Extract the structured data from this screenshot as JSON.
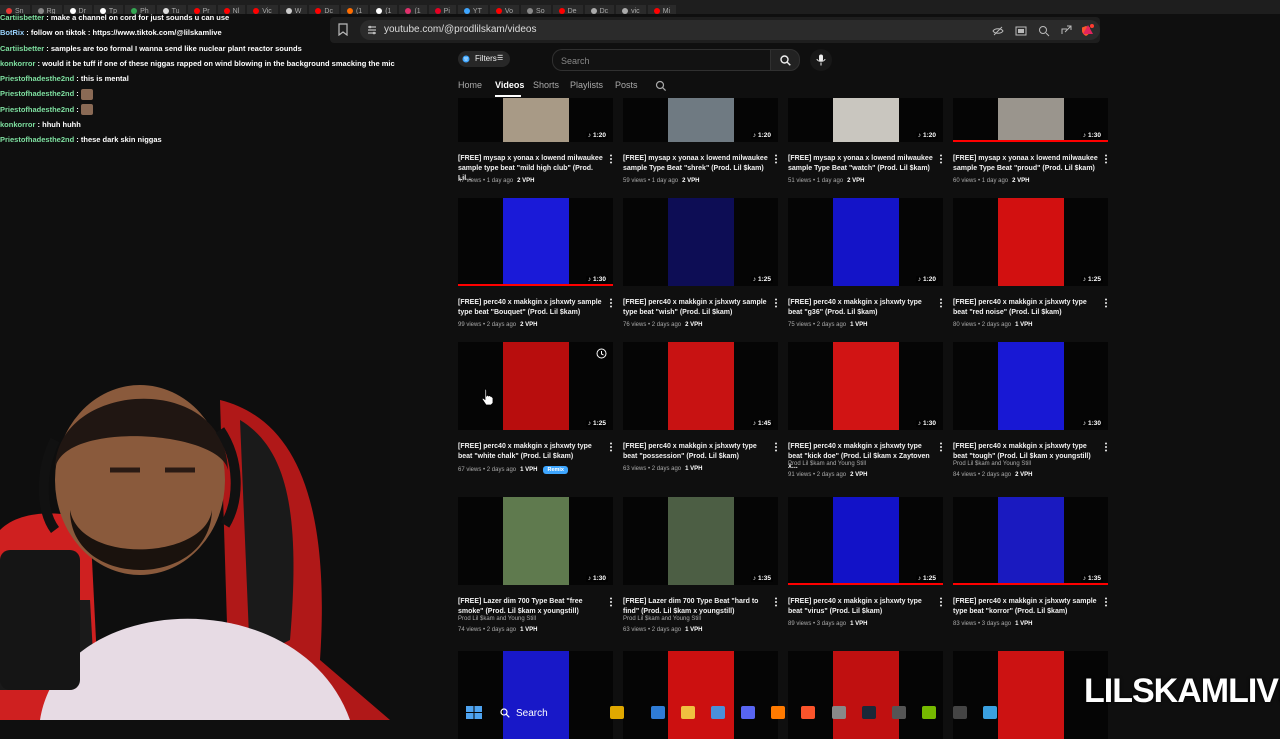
{
  "browser": {
    "tabs": [
      {
        "label": "Sn",
        "color": "#e53935"
      },
      {
        "label": "Rg",
        "color": "#888888"
      },
      {
        "label": "Dr",
        "color": "#ffffff"
      },
      {
        "label": "Tp",
        "color": "#ffffff"
      },
      {
        "label": "Ph",
        "color": "#34a853"
      },
      {
        "label": "Tu",
        "color": "#dddddd"
      },
      {
        "label": "Pr",
        "color": "#ff0000"
      },
      {
        "label": "Nl",
        "color": "#ff0000"
      },
      {
        "label": "Vic",
        "color": "#ff0000"
      },
      {
        "label": "W",
        "color": "#cccccc"
      },
      {
        "label": "Dc",
        "color": "#ff0000"
      },
      {
        "label": "(1",
        "color": "#ff6d00"
      },
      {
        "label": "(1",
        "color": "#ffffff"
      },
      {
        "label": "(1",
        "color": "#e1306c"
      },
      {
        "label": "Pi",
        "color": "#e60023"
      },
      {
        "label": "YT",
        "color": "#3ea6ff"
      },
      {
        "label": "Vo",
        "color": "#ff0000"
      },
      {
        "label": "So",
        "color": "#888888"
      },
      {
        "label": "De",
        "color": "#ff0000"
      },
      {
        "label": "Dc",
        "color": "#aaaaaa"
      },
      {
        "label": "vic",
        "color": "#aaaaaa"
      },
      {
        "label": "Mi",
        "color": "#ff0000"
      }
    ],
    "url": "youtube.com/@prodlilskam/videos"
  },
  "chat": [
    {
      "user": "Cartiisbetter",
      "msg": "make a channel on cord for just sounds u can use",
      "blue": false
    },
    {
      "user": "BotRix",
      "msg": "follow on tiktok : https://www.tiktok.com/@lilskamlive",
      "blue": true
    },
    {
      "user": "Cartiisbetter",
      "msg": "samples are too formal I wanna send like nuclear plant reactor sounds",
      "blue": false
    },
    {
      "user": "konkorror",
      "msg": "would it be tuff if one of these niggas rapped on wind blowing in the background smacking the mic",
      "blue": false
    },
    {
      "user": "Priestofhadesthe2nd",
      "msg": "this is mental",
      "blue": false
    },
    {
      "user": "Priestofhadesthe2nd",
      "msg": "",
      "blue": false,
      "emote": true
    },
    {
      "user": "Priestofhadesthe2nd",
      "msg": "",
      "blue": false,
      "emote": true
    },
    {
      "user": "konkorror",
      "msg": "hhuh huhh",
      "blue": false
    },
    {
      "user": "Priestofhadesthe2nd",
      "msg": "these dark skin niggas",
      "blue": false
    }
  ],
  "youtube": {
    "filters_label": "Filters",
    "search_placeholder": "Search",
    "channel_tabs": [
      "Home",
      "Videos",
      "Shorts",
      "Playlists",
      "Posts"
    ]
  },
  "videos": [
    {
      "title": "[FREE] mysap x yonaa x lowend milwaukee sample type beat \"mild high club\" (Prod. Lil...",
      "views": "47 views",
      "age": "1 day ago",
      "vph": "2 VPH",
      "duration": "1:20",
      "color": "#a89a86",
      "progress": 0,
      "channel": ""
    },
    {
      "title": "[FREE] mysap x yonaa x lowend milwaukee sample Type Beat \"shrek\" (Prod. Lil $kam)",
      "views": "59 views",
      "age": "1 day ago",
      "vph": "2 VPH",
      "duration": "1:20",
      "color": "#6f7a82",
      "progress": 0,
      "channel": ""
    },
    {
      "title": "[FREE] mysap x yonaa x lowend milwaukee sample Type Beat \"watch\" (Prod. Lil $kam)",
      "views": "51 views",
      "age": "1 day ago",
      "vph": "2 VPH",
      "duration": "1:20",
      "color": "#c9c6bf",
      "progress": 0,
      "channel": ""
    },
    {
      "title": "[FREE] mysap x yonaa x lowend milwaukee sample Type Beat \"proud\" (Prod. Lil $kam)",
      "views": "60 views",
      "age": "1 day ago",
      "vph": "2 VPH",
      "duration": "1:30",
      "color": "#9a958d",
      "progress": 1,
      "channel": ""
    },
    {
      "title": "[FREE] perc40 x makkgin x jshxwty sample type beat \"Bouquet\" (Prod. Lil $kam)",
      "views": "99 views",
      "age": "2 days ago",
      "vph": "2 VPH",
      "duration": "1:30",
      "color": "#1a1ad8",
      "progress": 1,
      "channel": ""
    },
    {
      "title": "[FREE] perc40 x makkgin x jshxwty sample type beat \"wish\" (Prod. Lil $kam)",
      "views": "76 views",
      "age": "2 days ago",
      "vph": "2 VPH",
      "duration": "1:25",
      "color": "#0d0d55",
      "progress": 0,
      "channel": ""
    },
    {
      "title": "[FREE] perc40 x makkgin x jshxwty type beat \"g36\" (Prod. Lil $kam)",
      "views": "75 views",
      "age": "2 days ago",
      "vph": "1 VPH",
      "duration": "1:20",
      "color": "#1414c8",
      "progress": 0,
      "channel": ""
    },
    {
      "title": "[FREE] perc40 x makkgin x jshxwty type beat \"red noise\" (Prod. Lil $kam)",
      "views": "80 views",
      "age": "2 days ago",
      "vph": "1 VPH",
      "duration": "1:25",
      "color": "#d21010",
      "progress": 0,
      "channel": ""
    },
    {
      "title": "[FREE] perc40 x makkgin x jshxwty type beat \"white chalk\" (Prod. Lil $kam)",
      "views": "67 views",
      "age": "2 days ago",
      "vph": "1 VPH",
      "duration": "1:25",
      "color": "#b80d0d",
      "progress": 0,
      "channel": "",
      "remix": "Remix",
      "clock": true
    },
    {
      "title": "[FREE] perc40 x makkgin x jshxwty type beat \"possession\" (Prod. Lil $kam)",
      "views": "63 views",
      "age": "2 days ago",
      "vph": "1 VPH",
      "duration": "1:45",
      "color": "#c81212",
      "progress": 0,
      "channel": ""
    },
    {
      "title": "[FREE] perc40 x makkgin x jshxwty type beat \"kick doe\" (Prod. Lil $kam x Zaytoven x...",
      "views": "91 views",
      "age": "2 days ago",
      "vph": "2 VPH",
      "duration": "1:30",
      "color": "#d11414",
      "progress": 0,
      "channel": "Prod Lil $kam and Young Still"
    },
    {
      "title": "[FREE] perc40 x makkgin x jshxwty type beat \"tough\" (Prod. Lil $kam x youngstill)",
      "views": "84 views",
      "age": "2 days ago",
      "vph": "2 VPH",
      "duration": "1:30",
      "color": "#1818d4",
      "progress": 0,
      "channel": "Prod Lil $kam and Young Still"
    },
    {
      "title": "[FREE] Lazer dim 700 Type Beat \"free smoke\" (Prod. Lil $kam x youngstill)",
      "views": "74 views",
      "age": "2 days ago",
      "vph": "1 VPH",
      "duration": "1:30",
      "color": "#5f7a4e",
      "progress": 0,
      "channel": "Prod Lil $kam and Young Still"
    },
    {
      "title": "[FREE] Lazer dim 700 Type Beat \"hard to find\" (Prod. Lil $kam x youngstill)",
      "views": "63 views",
      "age": "2 days ago",
      "vph": "1 VPH",
      "duration": "1:35",
      "color": "#4c5e44",
      "progress": 0,
      "channel": "Prod Lil $kam and Young Still"
    },
    {
      "title": "[FREE] perc40 x makkgin x jshxwty type beat \"virus\" (Prod. Lil $kam)",
      "views": "89 views",
      "age": "3 days ago",
      "vph": "1 VPH",
      "duration": "1:25",
      "color": "#1212c8",
      "progress": 1,
      "channel": ""
    },
    {
      "title": "[FREE] perc40 x makkgin x jshxwty sample type beat \"korror\" (Prod. Lil $kam)",
      "views": "83 views",
      "age": "3 days ago",
      "vph": "1 VPH",
      "duration": "1:35",
      "color": "#1a1ac0",
      "progress": 1,
      "channel": ""
    },
    {
      "title": "",
      "views": "",
      "age": "",
      "vph": "",
      "duration": "",
      "color": "#1818c8",
      "progress": 0,
      "channel": ""
    },
    {
      "title": "",
      "views": "",
      "age": "",
      "vph": "",
      "duration": "",
      "color": "#cc1010",
      "progress": 0,
      "channel": ""
    },
    {
      "title": "",
      "views": "",
      "age": "",
      "vph": "",
      "duration": "",
      "color": "#c01010",
      "progress": 0,
      "channel": ""
    },
    {
      "title": "",
      "views": "",
      "age": "",
      "vph": "",
      "duration": "",
      "color": "#cc1212",
      "progress": 0,
      "channel": ""
    }
  ],
  "overlay": {
    "watermark": "LILSKAMLIVE"
  },
  "taskbar": {
    "search_label": "Search",
    "apps": [
      {
        "name": "file-explorer-icon",
        "color": "#e0a800"
      },
      {
        "name": "edge-icon",
        "color": "#2f7cd6"
      },
      {
        "name": "folder-icon",
        "color": "#f0c040"
      },
      {
        "name": "store-icon",
        "color": "#4a90d9"
      },
      {
        "name": "discord-icon",
        "color": "#5865f2"
      },
      {
        "name": "fl-studio-icon",
        "color": "#ff7a00"
      },
      {
        "name": "brave-icon",
        "color": "#fb542b"
      },
      {
        "name": "obs-icon",
        "color": "#888888"
      },
      {
        "name": "steam-icon",
        "color": "#1b2838"
      },
      {
        "name": "app-icon",
        "color": "#555555"
      },
      {
        "name": "nvidia-icon",
        "color": "#76b900"
      },
      {
        "name": "4k-icon",
        "color": "#444444"
      },
      {
        "name": "notepad-icon",
        "color": "#3aa0e0"
      }
    ]
  }
}
